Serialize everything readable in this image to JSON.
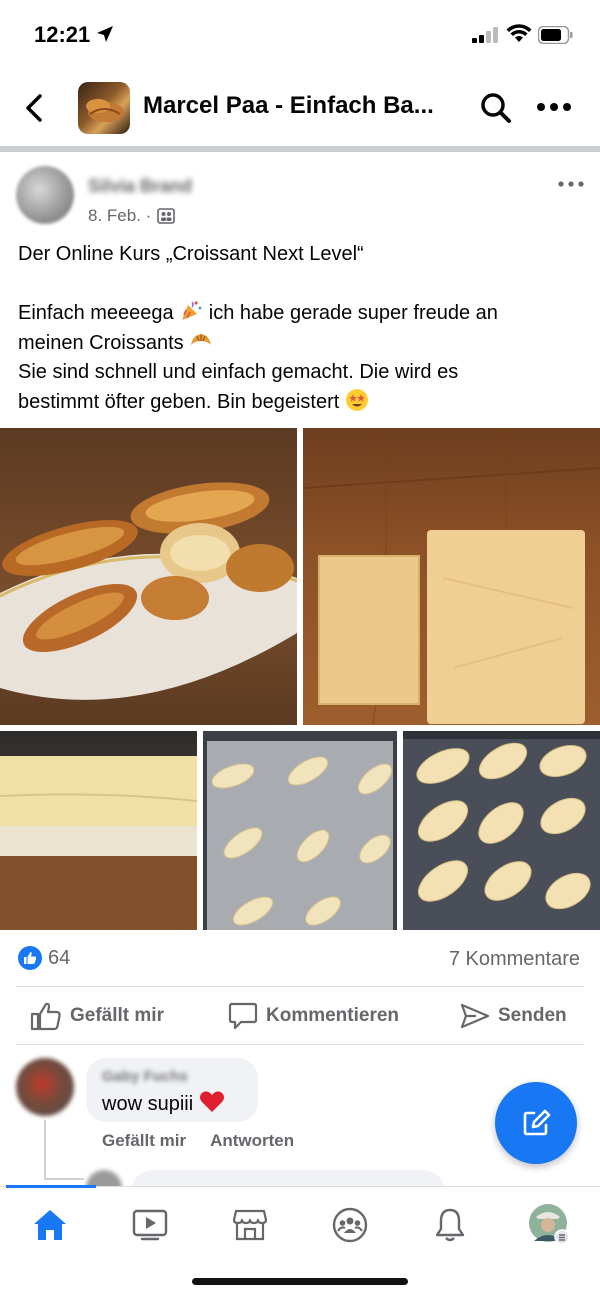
{
  "status_bar": {
    "time": "12:21"
  },
  "header": {
    "title": "Marcel Paa - Einfach Ba..."
  },
  "post": {
    "author": "Silvia Brand",
    "date": "8. Feb. ·",
    "title_line": "Der Online Kurs „Croissant Next Level“",
    "line1": "Einfach meeeega",
    "line1b": "ich habe gerade super freude an",
    "line2": "meinen Croissants",
    "line3": "Sie sind schnell und einfach gemacht. Die wird es",
    "line4": "bestimmt öfter geben. Bin begeistert",
    "reactions_count": "64",
    "comments_count": "7 Kommentare"
  },
  "actions": {
    "like": "Gefällt mir",
    "comment": "Kommentieren",
    "send": "Senden"
  },
  "comment": {
    "author": "Gaby Fuchs",
    "text": "wow supiii",
    "like": "Gefällt mir",
    "reply": "Antworten"
  },
  "colors": {
    "accent": "#1877f2",
    "text": "#050505",
    "muted": "#65676b"
  },
  "icons": [
    "back-arrow-icon",
    "search-icon",
    "more-icon",
    "like-icon",
    "comment-icon",
    "send-icon",
    "compose-icon",
    "home-icon",
    "video-icon",
    "marketplace-icon",
    "groups-icon",
    "bell-icon"
  ]
}
